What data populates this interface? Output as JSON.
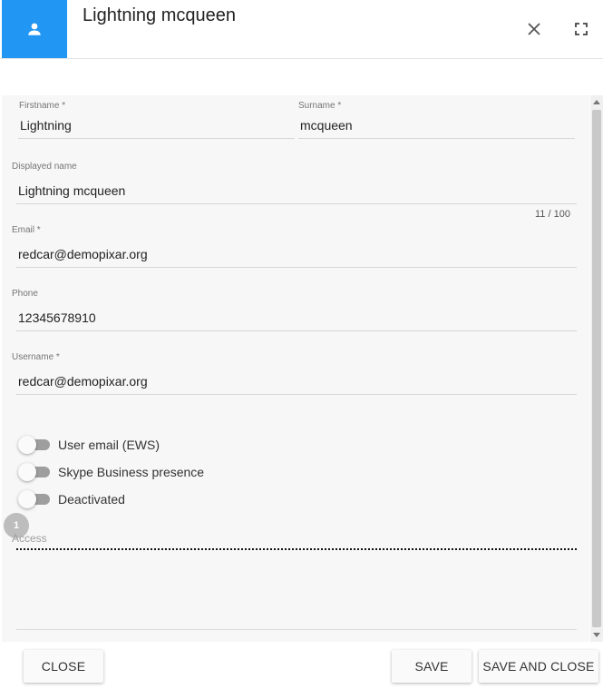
{
  "header": {
    "title": "Lightning mcqueen",
    "avatar_icon": "person-icon",
    "close_icon": "close-icon",
    "fullscreen_icon": "fullscreen-icon",
    "accent_color": "#2196f3"
  },
  "form": {
    "firstname": {
      "label": "Firstname *",
      "value": "Lightning"
    },
    "surname": {
      "label": "Surname *",
      "value": "mcqueen"
    },
    "displayed_name": {
      "label": "Displayed name",
      "value": "Lightning mcqueen",
      "counter": "11 / 100"
    },
    "email": {
      "label": "Email *",
      "value": "redcar@demopixar.org"
    },
    "phone": {
      "label": "Phone",
      "value": "12345678910"
    },
    "username": {
      "label": "Username *",
      "value": "redcar@demopixar.org"
    }
  },
  "toggles": [
    {
      "label": "User email (EWS)",
      "checked": false
    },
    {
      "label": "Skype Business presence",
      "checked": false
    },
    {
      "label": "Deactivated",
      "checked": false
    }
  ],
  "access": {
    "badge": "1",
    "label": "Access"
  },
  "footer": {
    "close_label": "CLOSE",
    "save_label": "SAVE",
    "save_close_label": "SAVE AND CLOSE"
  }
}
